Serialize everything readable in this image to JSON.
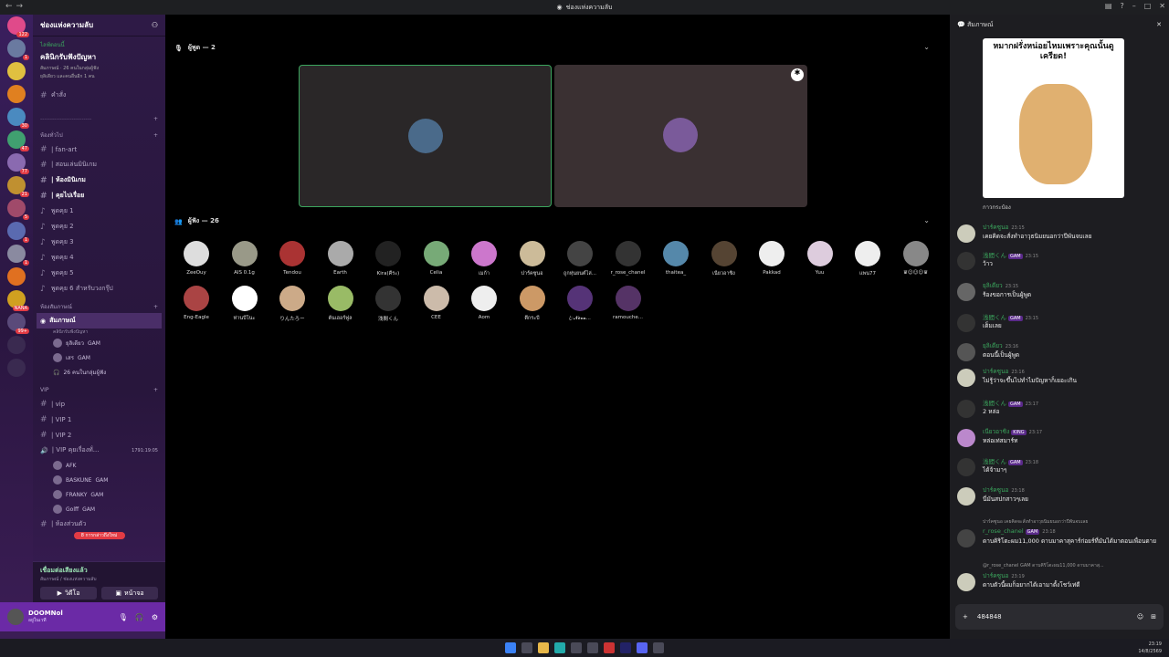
{
  "window": {
    "title": "ช่องแห่งความลับ"
  },
  "guilds": [
    {
      "badge": "122"
    },
    {
      "badge": "1"
    },
    {
      "badge": ""
    },
    {
      "badge": ""
    },
    {
      "badge": "30"
    },
    {
      "badge": "47"
    },
    {
      "badge": "77"
    },
    {
      "badge": "21"
    },
    {
      "badge": "5"
    },
    {
      "badge": "1"
    },
    {
      "badge": "1"
    },
    {
      "badge": ""
    },
    {
      "badge": "NANA"
    },
    {
      "badge": "99+"
    }
  ],
  "server": {
    "name": "ช่องแห่งความลับ"
  },
  "event": {
    "live": "ไลฟ์ตอนนี้",
    "title": "คลินิกรับฟังปัญหา",
    "line1": "สัมภาษณ์ · 26 คนในกลุ่มผู้ฟัง",
    "line2": "ยุลิเดียว และคนอื่นอีก 1 คน"
  },
  "pinned_channel": "คำสั่ง",
  "general_cat": "ห้องทั่วไป",
  "text_channels": [
    "| fan-art",
    "| สอนเล่นมินิเกม",
    "| ห้องมินิเกม",
    "| คุยไปเรื่อย"
  ],
  "voice_channels": [
    "พูดคุย 1",
    "พูดคุย 2",
    "พูดคุย 3",
    "พูดคุย 4",
    "พูดคุย 5",
    "พูดคุย 6 สำหรับวงกรุ๊ป"
  ],
  "stage_cat": "ห้องสัมภาษณ์",
  "stage": {
    "name": "สัมภาษณ์",
    "sub": "คลินิกรับฟังปัญหา",
    "speakers": [
      {
        "name": "ยุลิเดียว",
        "tag": "GAM"
      },
      {
        "name": "เสร",
        "tag": "GAM"
      }
    ],
    "listeners": "26 คนในกลุ่มผู้ฟัง"
  },
  "vip_cat": "VIP",
  "vip_channels": [
    "| vip",
    "| VIP 1",
    "| VIP 2"
  ],
  "vip_voice": {
    "name": "| VIP คุยเรื่องทั่...",
    "time": "1791:19:05",
    "users": [
      {
        "name": "AFK",
        "tag": ""
      },
      {
        "name": "BASKUNE",
        "tag": "GAM"
      },
      {
        "name": "FRANKY",
        "tag": "GAM"
      },
      {
        "name": "Golff",
        "tag": "GAM"
      }
    ]
  },
  "private_channel": "| ห้องส่วนตัว",
  "unread_pill": "8 การกล่าวถึงใหม่",
  "voice_status": {
    "status": "เชื่อมต่อเสียงแล้ว",
    "sub": "สัมภาษณ์ / ช่องแห่งความลับ",
    "video": "วิดีโอ",
    "screen": "หน้าจอ"
  },
  "user": {
    "name": "DOOMNol",
    "status": "อยู่ในเวที"
  },
  "speakers_header": "ผู้พูด — 2",
  "listeners_header": "ผู้ฟัง — 26",
  "listeners": [
    "ZeeOuy",
    "AIS 0.1g",
    "Tendou",
    "Earth",
    "Kira(คีระ)",
    "Celia",
    "เมก้า",
    "ปาร์คซูนอ",
    "ถูกหุ่นยนต์ไล่...",
    "r_rose_chanel",
    "thaitea_",
    "เนียวอาซิง",
    "Pakkad",
    "Yuu",
    "แพน77",
    "♛☺☺☺♛",
    "Eng-Eagle",
    "ท่านบีโนะ",
    "りんたろー",
    "ต้นเฮอร์ฟูล",
    "浅間くん",
    "CEE",
    "Aom",
    "ตึกระบี",
    "ꦿ𝓝𝓮𝓿𝓪...",
    "ramouche..."
  ],
  "panel_title": "สัมภาษณ์",
  "sticker": {
    "caption": "หมากฝรั่งหน่อยไหมเพราะคุณนั้นดูเครียด!",
    "label": "กาวกระป๋อง"
  },
  "messages": [
    {
      "name": "ปาร์คซูนอ",
      "time": "23:15",
      "tag": "",
      "text": "เคยคิดจะสั่งทำอาวุธนิมยนอกว่าปีพันจบเลย"
    },
    {
      "name": "浅間くん",
      "time": "23:15",
      "tag": "GAM",
      "text": "ว้าว"
    },
    {
      "name": "ยุลิเดียว",
      "time": "23:15",
      "tag": "",
      "text": "ร้องขอการเป็นผู้พูด"
    },
    {
      "name": "浅間くん",
      "time": "23:15",
      "tag": "GAM",
      "text": "เต็มเลย"
    },
    {
      "name": "ยุลิเดียว",
      "time": "23:16",
      "tag": "",
      "text": "ตอนนี้เป็นผู้พูด"
    },
    {
      "name": "ปาร์คซูนอ",
      "time": "23:16",
      "tag": "",
      "text": "ไม่รู้ว่าจะขึ้นไปทำไมปัญหาก็เยอะเกิน"
    },
    {
      "name": "浅間くん",
      "time": "23:17",
      "tag": "GAM",
      "text": "2 หล่อ"
    },
    {
      "name": "เนียวอาซิง",
      "time": "23:17",
      "tag": "KING",
      "text": "หล่อเท่สมาร์ท"
    },
    {
      "name": "浅間くん",
      "time": "23:18",
      "tag": "GAM",
      "text": "ได้จ้ามาๆ"
    },
    {
      "name": "ปาร์คซูนอ",
      "time": "23:18",
      "tag": "",
      "text": "นี่มันสปกสาวๆเลย"
    },
    {
      "name": "r_rose_chanel",
      "time": "23:18",
      "tag": "GAM",
      "text": "ดาบคิริโตะผม11,000 ดาบมาคาสุคาร์ก่อยร์ที่มันได้มาตอนเพื่อนตาย"
    },
    {
      "name": "ปาร์คซูนอ",
      "time": "23:19",
      "tag": "",
      "text": "ดาบตัวนี้ผมก็อยากได้เอามาตั้งโชว์เท่ดี"
    }
  ],
  "replies": [
    "ปาร์คซูนอ เคยคิดจะสั่งทำอาวุธนิมยนอกว่าปีพันจบเลย",
    "@r_rose_chanel GAM ดาบคิริโตะผม11,000 ดาบมาคาสุ..."
  ],
  "input": {
    "value": "484848"
  },
  "clock": {
    "time": "23:19",
    "date": "14/8/2569"
  }
}
